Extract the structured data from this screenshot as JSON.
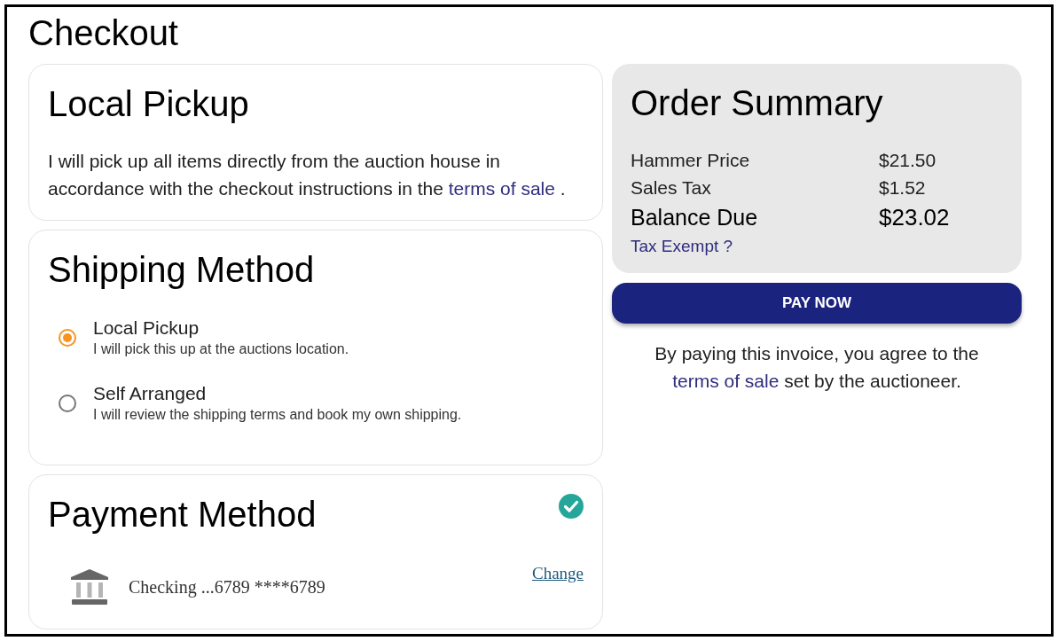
{
  "page": {
    "title": "Checkout"
  },
  "local_pickup": {
    "title": "Local Pickup",
    "text_before": "I will pick up all items directly from the auction house in accordance with the checkout instructions in the",
    "link": "terms of sale",
    "text_after": "."
  },
  "shipping_method": {
    "title": "Shipping Method",
    "options": [
      {
        "label": "Local Pickup",
        "description": "I will pick this up at the auctions location.",
        "selected": true
      },
      {
        "label": "Self Arranged",
        "description": "I will review the shipping terms and book my own shipping.",
        "selected": false
      }
    ]
  },
  "payment_method": {
    "title": "Payment Method",
    "complete": true,
    "account": "Checking ...6789 ****6789",
    "change_link": "Change"
  },
  "order_summary": {
    "title": "Order Summary",
    "lines": [
      {
        "kind": "line",
        "label": "Hammer Price",
        "value": "$21.50"
      },
      {
        "kind": "line",
        "label": "Sales Tax",
        "value": "$1.52"
      },
      {
        "kind": "total",
        "label": "Balance Due",
        "value": "$23.02"
      }
    ],
    "tax_exempt_link": "Tax Exempt ?"
  },
  "pay_button": "PAY NOW",
  "agreement": {
    "text_before": "By paying this invoice, you agree to the",
    "link": "terms of sale",
    "text_after": "set by the auctioneer."
  }
}
